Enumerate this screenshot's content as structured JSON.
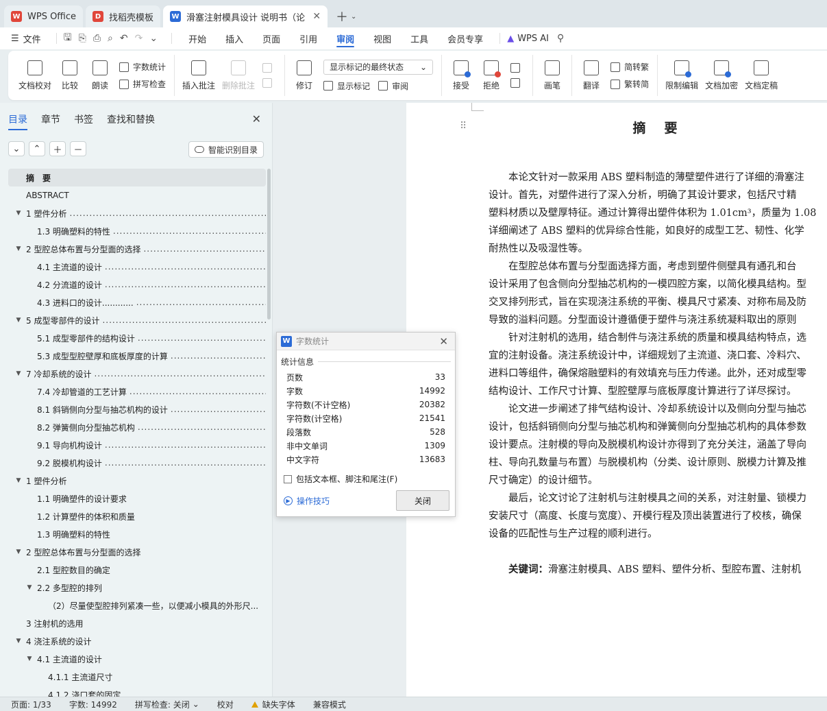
{
  "tabs": [
    {
      "label": "WPS Office",
      "logo": "W",
      "color": "#e0463a"
    },
    {
      "label": "找稻壳模板",
      "logo": "D",
      "color": "#e0463a"
    },
    {
      "label": "滑塞注射模具设计 说明书（论",
      "logo": "W",
      "color": "#2c6bd6"
    }
  ],
  "menu": {
    "file_label": "文件",
    "tabs": [
      "开始",
      "插入",
      "页面",
      "引用",
      "审阅",
      "视图",
      "工具",
      "会员专享"
    ],
    "active_tab": "审阅",
    "ai_label": "WPS AI"
  },
  "ribbon": {
    "proofread": "文档校对",
    "compare": "比较",
    "read_aloud": "朗读",
    "word_count": "字数统计",
    "spell_check": "拼写检查",
    "insert_comment": "插入批注",
    "delete_comment": "删除批注",
    "track_changes": "修订",
    "markup_state": "显示标记的最终状态",
    "show_markup": "显示标记",
    "review_pane": "审阅",
    "accept": "接受",
    "reject": "拒绝",
    "pen": "画笔",
    "translate": "翻译",
    "to_traditional": "简转繁",
    "to_simplified": "繁转简",
    "restrict_edit": "限制编辑",
    "encrypt": "文档加密",
    "finalize": "文档定稿"
  },
  "nav": {
    "tabs": [
      "目录",
      "章节",
      "书签",
      "查找和替换"
    ],
    "smart_toc": "智能识别目录",
    "toc": [
      {
        "text": "摘　要",
        "level": 0,
        "arrow": "",
        "dots": false,
        "selected": true
      },
      {
        "text": "ABSTRACT",
        "level": 0,
        "arrow": "",
        "dots": false
      },
      {
        "text": "1  塑件分析",
        "level": 0,
        "arrow": "▼",
        "dots": true
      },
      {
        "text": "1.3  明确塑料的特性",
        "level": 1,
        "arrow": "",
        "dots": true
      },
      {
        "text": "2  型腔总体布置与分型面的选择",
        "level": 0,
        "arrow": "▼",
        "dots": true
      },
      {
        "text": "4.1 主流道的设计",
        "level": 1,
        "arrow": "",
        "dots": true
      },
      {
        "text": "4.2 分流道的设计",
        "level": 1,
        "arrow": "",
        "dots": true
      },
      {
        "text": "4.3  进料口的设计............        ",
        "level": 1,
        "arrow": "",
        "dots": true
      },
      {
        "text": "5  成型零部件的设计",
        "level": 0,
        "arrow": "▼",
        "dots": true
      },
      {
        "text": "5.1 成型零部件的结构设计",
        "level": 1,
        "arrow": "",
        "dots": true
      },
      {
        "text": "5.3  成型型腔壁厚和底板厚度的计算",
        "level": 1,
        "arrow": "",
        "dots": true
      },
      {
        "text": "7  冷却系统的设计",
        "level": 0,
        "arrow": "▼",
        "dots": true
      },
      {
        "text": "7.4  冷却管道的工艺计算",
        "level": 1,
        "arrow": "",
        "dots": true
      },
      {
        "text": "8.1  斜销侧向分型与抽芯机构的设计",
        "level": 1,
        "arrow": "",
        "dots": true
      },
      {
        "text": "8.2  弹簧侧向分型抽芯机构",
        "level": 1,
        "arrow": "",
        "dots": true
      },
      {
        "text": "9.1  导向机构设计",
        "level": 1,
        "arrow": "",
        "dots": true
      },
      {
        "text": "9.2  脱模机构设计",
        "level": 1,
        "arrow": "",
        "dots": true
      },
      {
        "text": "1  塑件分析",
        "level": 0,
        "arrow": "▼",
        "dots": false
      },
      {
        "text": "1.1  明确塑件的设计要求",
        "level": 1,
        "arrow": "",
        "dots": false
      },
      {
        "text": "1.2  计算塑件的体积和质量",
        "level": 1,
        "arrow": "",
        "dots": false
      },
      {
        "text": "1.3  明确塑料的特性",
        "level": 1,
        "arrow": "",
        "dots": false
      },
      {
        "text": "2  型腔总体布置与分型面的选择",
        "level": 0,
        "arrow": "▼",
        "dots": false
      },
      {
        "text": "2.1  型腔数目的确定",
        "level": 1,
        "arrow": "",
        "dots": false
      },
      {
        "text": "2.2  多型腔的排列",
        "level": 1,
        "arrow": "▼",
        "dots": false
      },
      {
        "text": "（2）尽量使型腔排列紧凑一些，以便减小模具的外形尺...",
        "level": 2,
        "arrow": "",
        "dots": false
      },
      {
        "text": "3  注射机的选用",
        "level": 0,
        "arrow": "",
        "dots": false
      },
      {
        "text": "4  浇注系统的设计",
        "level": 0,
        "arrow": "▼",
        "dots": false
      },
      {
        "text": "4.1  主流道的设计",
        "level": 1,
        "arrow": "▼",
        "dots": false
      },
      {
        "text": "4.1.1 主流道尺寸",
        "level": 2,
        "arrow": "",
        "dots": false
      },
      {
        "text": "4.1.2  浇口套的固定",
        "level": 2,
        "arrow": "",
        "dots": false
      }
    ]
  },
  "doc": {
    "title": "摘　要",
    "lines": [
      "　　本论文针对一款采用 ABS 塑料制造的薄壁塑件进行了详细的滑塞注",
      "设计。首先，对塑件进行了深入分析，明确了其设计要求，包括尺寸精",
      "塑料材质以及壁厚特征。通过计算得出塑件体积为 1.01cm³，质量为 1.08",
      "详细阐述了 ABS 塑料的优异综合性能，如良好的成型工艺、韧性、化学",
      "耐热性以及吸湿性等。",
      "　　在型腔总体布置与分型面选择方面，考虑到塑件侧壁具有通孔和台",
      "设计采用了包含侧向分型抽芯机构的一模四腔方案，以简化模具结构。型",
      "交叉排列形式，旨在实现浇注系统的平衡、模具尺寸紧凑、对称布局及防",
      "导致的溢料问题。分型面设计遵循便于塑件与浇注系统凝料取出的原则",
      "　　针对注射机的选用，结合制件与浇注系统的质量和模具结构特点，选",
      "宜的注射设备。浇注系统设计中，详细规划了主流道、浇口套、冷料穴、",
      "进料口等组件，确保熔融塑料的有效填充与压力传递。此外，还对成型零",
      "结构设计、工作尺寸计算、型腔壁厚与底板厚度计算进行了详尽探讨。",
      "　　论文进一步阐述了排气结构设计、冷却系统设计以及侧向分型与抽芯",
      "设计，包括斜销侧向分型与抽芯机构和弹簧侧向分型抽芯机构的具体参数",
      "设计要点。注射模的导向及脱模机构设计亦得到了充分关注，涵盖了导向",
      "柱、导向孔数量与布置）与脱模机构（分类、设计原则、脱模力计算及推",
      "尺寸确定）的设计细节。",
      "　　最后，论文讨论了注射机与注射模具之间的关系，对注射量、锁模力",
      "安装尺寸（高度、长度与宽度）、开模行程及顶出装置进行了校核，确保",
      "设备的匹配性与生产过程的顺利进行。"
    ],
    "keywords_label": "　　关键词：",
    "keywords": "滑塞注射模具、ABS 塑料、塑件分析、型腔布置、注射机"
  },
  "dialog": {
    "title": "字数统计",
    "section": "统计信息",
    "stats": [
      {
        "label": "页数",
        "value": "33"
      },
      {
        "label": "字数",
        "value": "14992"
      },
      {
        "label": "字符数(不计空格)",
        "value": "20382"
      },
      {
        "label": "字符数(计空格)",
        "value": "21541"
      },
      {
        "label": "段落数",
        "value": "528"
      },
      {
        "label": "非中文单词",
        "value": "1309"
      },
      {
        "label": "中文字符",
        "value": "13683"
      }
    ],
    "include_label": "包括文本框、脚注和尾注(F)",
    "tips_label": "操作技巧",
    "close_label": "关闭"
  },
  "status": {
    "page": "页面: 1/33",
    "words": "字数: 14992",
    "spell": "拼写检查: 关闭",
    "proof": "校对",
    "missing_font": "缺失字体",
    "compat": "兼容模式"
  }
}
